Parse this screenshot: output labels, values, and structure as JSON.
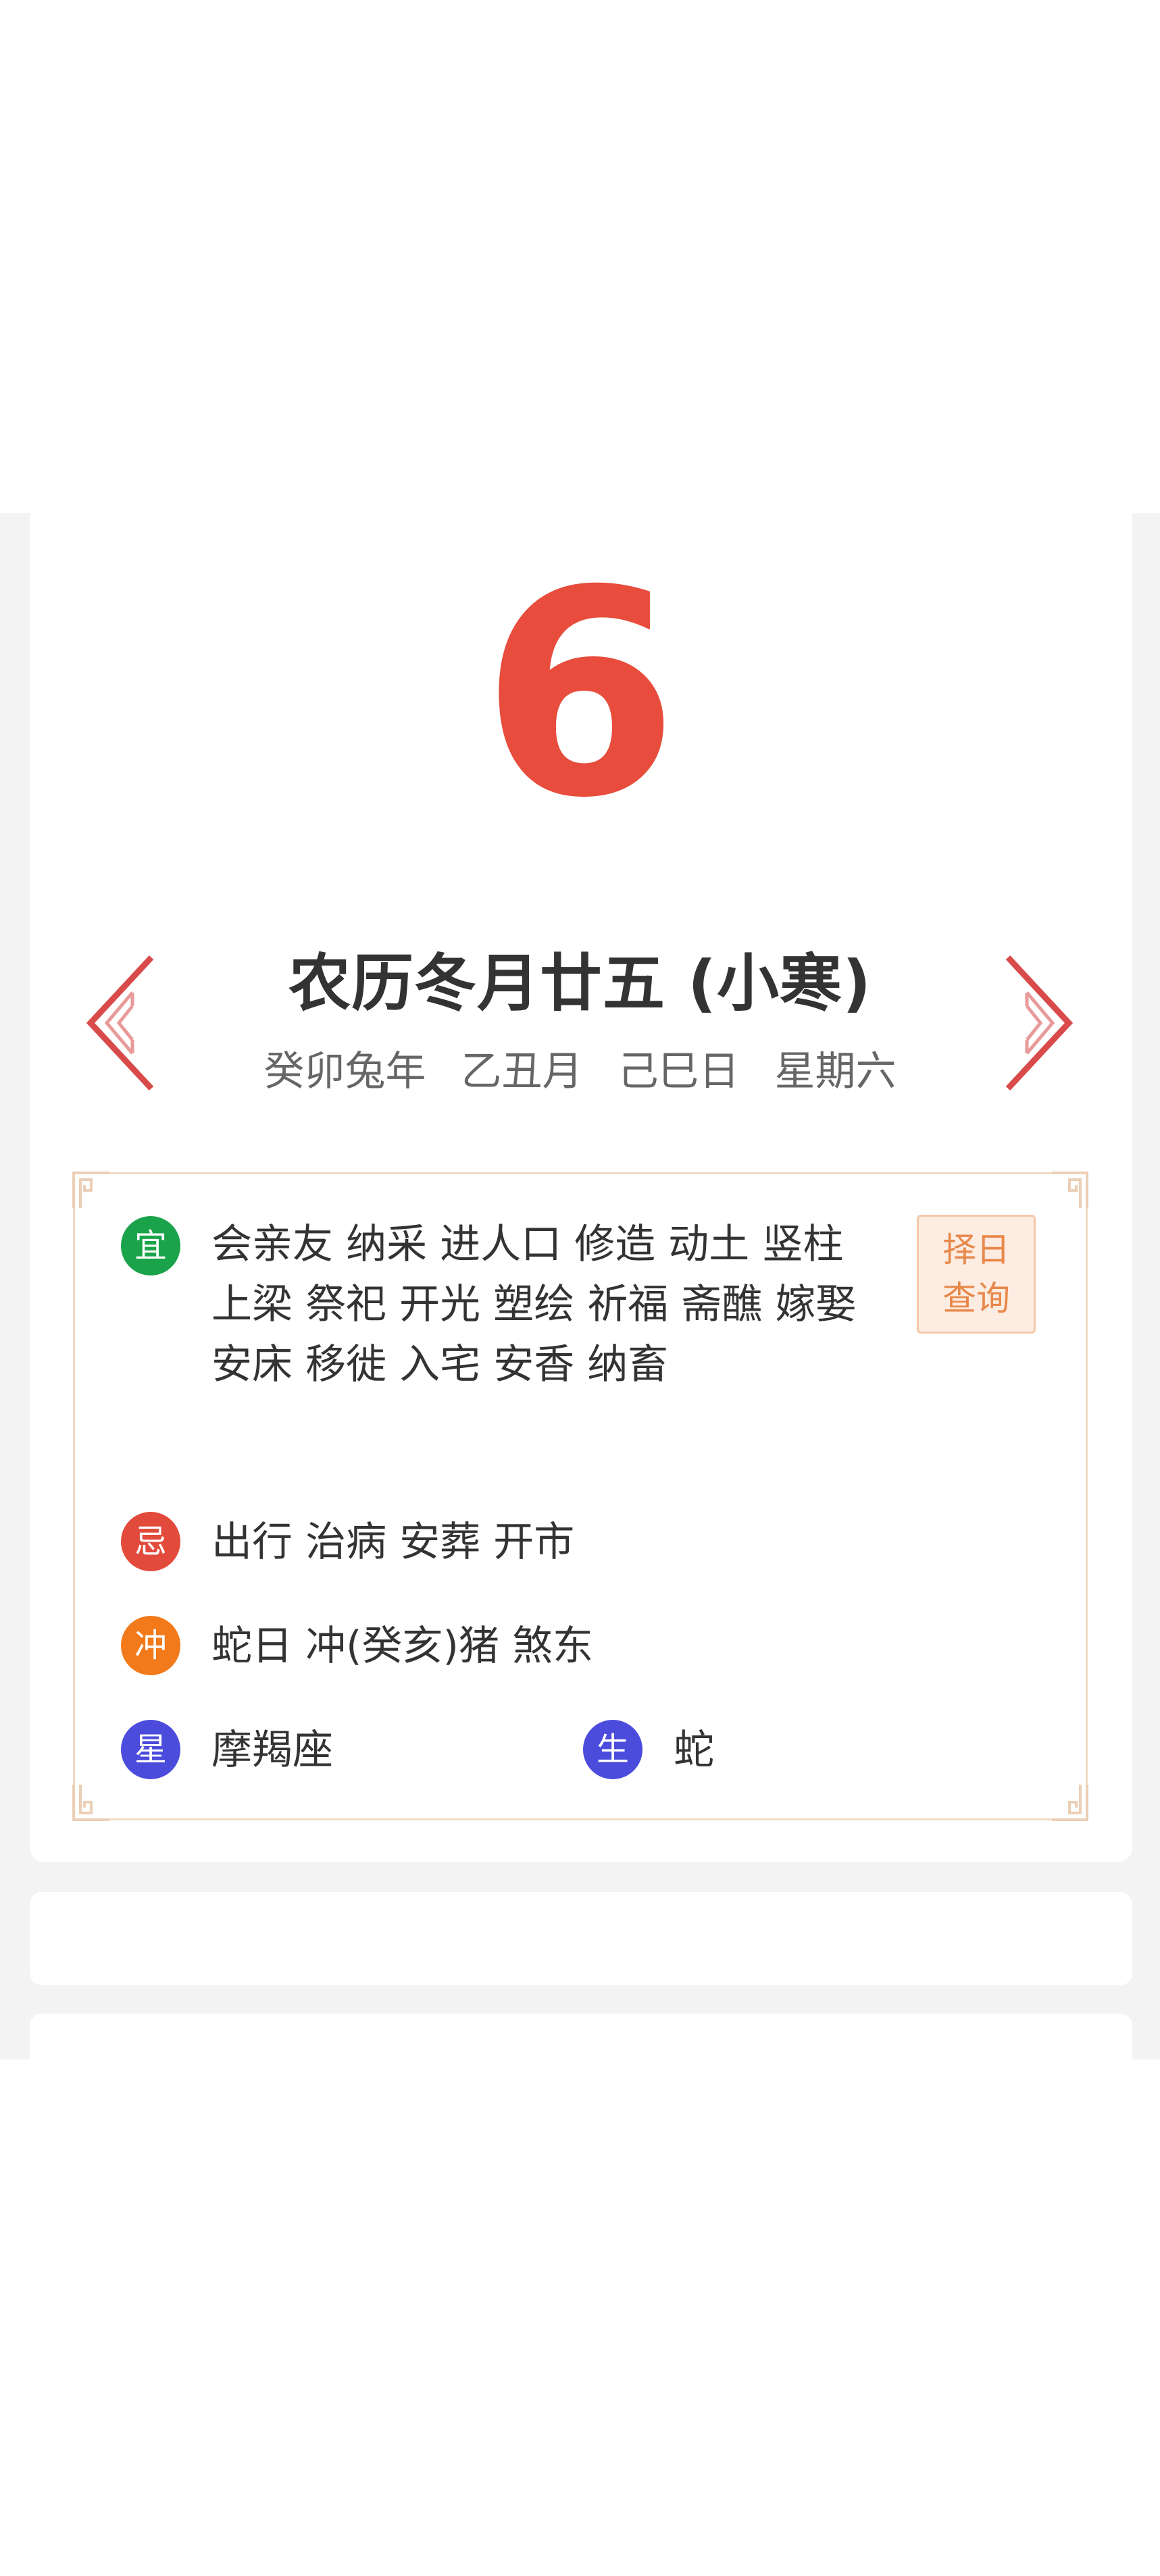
{
  "calendar": {
    "day_number": "6",
    "lunar_title": "农历冬月廿五 (小寒)",
    "ganzhi": {
      "year": "癸卯兔年",
      "month": "乙丑月",
      "day": "己巳日",
      "weekday": "星期六"
    }
  },
  "almanac": {
    "yi": {
      "badge": "宜",
      "text": "会亲友  纳采  进人口  修造  动土  竖柱  上梁  祭祀  开光  塑绘  祈福  斋醮  嫁娶  安床  移徙  入宅  安香  纳畜"
    },
    "ji": {
      "badge": "忌",
      "text": "出行  治病  安葬  开市"
    },
    "chong": {
      "badge": "冲",
      "text": "蛇日 冲(癸亥)猪  煞东"
    },
    "xing": {
      "badge": "星",
      "text": "摩羯座"
    },
    "sheng": {
      "badge": "生",
      "text": "蛇"
    },
    "zeri_button": {
      "line1": "择日",
      "line2": "查询"
    }
  },
  "colors": {
    "accent_red": "#e74c3c",
    "yi_green": "#1aa34a",
    "ji_red": "#e24a3b",
    "chong_orange": "#f27a1a",
    "xing_blue": "#4b4bdc",
    "border_beige": "#f1d9c4"
  },
  "icons": {
    "prev": "chevron-left-icon",
    "next": "chevron-right-icon"
  }
}
